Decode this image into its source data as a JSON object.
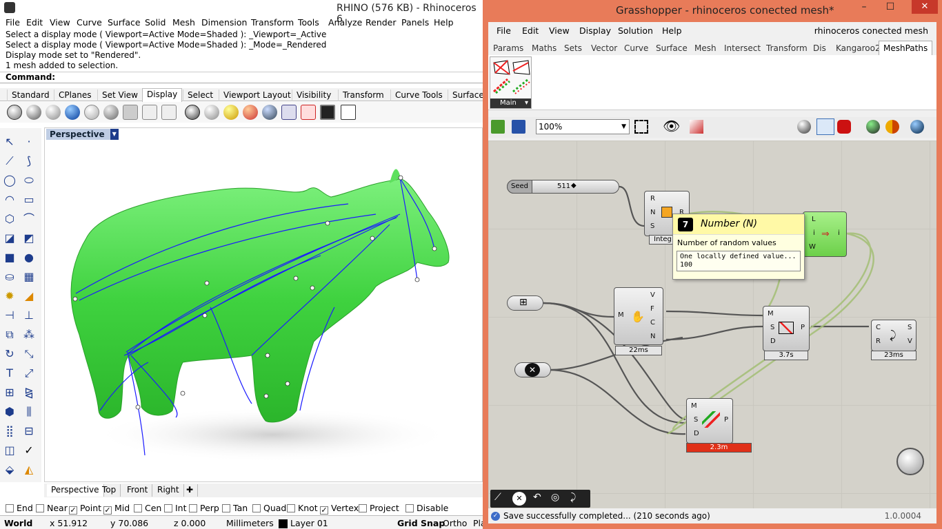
{
  "rhino": {
    "title": "RHINO (576 KB) - Rhinoceros 6",
    "menu": [
      "File",
      "Edit",
      "View",
      "Curve",
      "Surface",
      "Solid",
      "Mesh",
      "Dimension",
      "Transform",
      "Tools",
      "Analyze",
      "Render",
      "Panels",
      "Help"
    ],
    "history": [
      "Select a display mode ( Viewport=Active  Mode=Shaded ): _Viewport=_Active",
      "Select a display mode ( Viewport=Active  Mode=Shaded ): _Mode=_Rendered",
      "Display mode set to \"Rendered\".",
      "1 mesh added to selection."
    ],
    "command_label": "Command:",
    "tabs": [
      "Standard",
      "CPlanes",
      "Set View",
      "Display",
      "Select",
      "Viewport Layout",
      "Visibility",
      "Transform",
      "Curve Tools",
      "Surface"
    ],
    "active_tab": "Display",
    "viewport_label": "Perspective",
    "viewport_tabs": [
      "Perspective",
      "Top",
      "Front",
      "Right"
    ],
    "osnaps": [
      {
        "label": "End",
        "checked": false
      },
      {
        "label": "Near",
        "checked": false
      },
      {
        "label": "Point",
        "checked": true
      },
      {
        "label": "Mid",
        "checked": true
      },
      {
        "label": "Cen",
        "checked": false
      },
      {
        "label": "Int",
        "checked": false
      },
      {
        "label": "Perp",
        "checked": false
      },
      {
        "label": "Tan",
        "checked": false
      },
      {
        "label": "Quad",
        "checked": false
      },
      {
        "label": "Knot",
        "checked": false
      },
      {
        "label": "Vertex",
        "checked": true
      },
      {
        "label": "Project",
        "checked": false
      },
      {
        "label": "Disable",
        "checked": false
      }
    ],
    "status": {
      "cplane": "World",
      "x": "x 51.912",
      "y": "y 70.086",
      "z": "z 0.000",
      "units": "Millimeters",
      "layer": "Layer 01",
      "grid_snap": "Grid Snap",
      "ortho": "Ortho",
      "planar": "Pla"
    }
  },
  "grasshopper": {
    "title": "Grasshopper - rhinoceros conected mesh*",
    "menu": [
      "File",
      "Edit",
      "View",
      "Display",
      "Solution",
      "Help"
    ],
    "document_name": "rhinoceros conected mesh",
    "tabs": [
      "Params",
      "Maths",
      "Sets",
      "Vector",
      "Curve",
      "Surface",
      "Mesh",
      "Intersect",
      "Transform",
      "Dis",
      "Kangaroo2",
      "MeshPaths"
    ],
    "active_tab": "MeshPaths",
    "ribbon_group": "Main",
    "zoom": "100%",
    "slider": {
      "label": "Seed",
      "value": "511"
    },
    "random": {
      "inputs": [
        "R",
        "N",
        "S"
      ],
      "outputs": [
        "R"
      ],
      "timer": "Integ"
    },
    "weave": {
      "inputs": [
        "L",
        "i",
        "W"
      ],
      "outputs": [
        "i"
      ]
    },
    "mesh_comp": {
      "inputs": [
        "M"
      ],
      "outputs": [
        "V",
        "F",
        "C",
        "N"
      ],
      "timer": "22ms"
    },
    "path_comp": {
      "inputs": [
        "M",
        "S",
        "D"
      ],
      "outputs": [
        "P"
      ],
      "timer": "3.7s"
    },
    "curve_comp": {
      "inputs": [
        "C",
        "R"
      ],
      "outputs": [
        "S",
        "V"
      ],
      "timer": "23ms"
    },
    "path2_comp": {
      "inputs": [
        "M",
        "S",
        "D"
      ],
      "outputs": [
        "P"
      ],
      "timer": "2.3m"
    },
    "tooltip": {
      "icon": "7",
      "title": "Number (N)",
      "description": "Number of random values",
      "value_line1": "One locally defined value...",
      "value_line2": "100"
    },
    "status_message": "Save successfully completed... (210 seconds ago)",
    "version": "1.0.0004"
  },
  "colors": {
    "gh_border": "#e87b59",
    "mesh_green": "#4ee04e",
    "path_blue": "#1a1aff",
    "viewport_label": "#bfcde4",
    "error_red": "#e03018",
    "ok_green": "#6ed04a"
  }
}
